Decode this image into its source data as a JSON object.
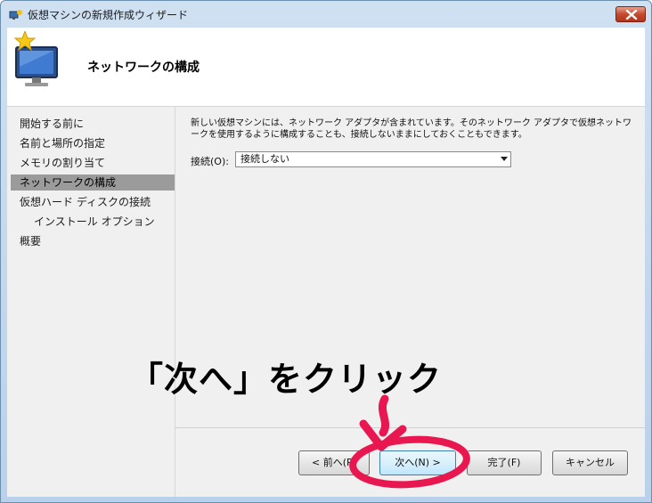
{
  "window": {
    "title": "仮想マシンの新規作成ウィザード"
  },
  "header": {
    "page_title": "ネットワークの構成"
  },
  "nav": {
    "items": [
      {
        "label": "開始する前に"
      },
      {
        "label": "名前と場所の指定"
      },
      {
        "label": "メモリの割り当て"
      },
      {
        "label": "ネットワークの構成"
      },
      {
        "label": "仮想ハード ディスクの接続"
      },
      {
        "label": "インストール オプション"
      },
      {
        "label": "概要"
      }
    ],
    "active_index": 3
  },
  "main": {
    "description": "新しい仮想マシンには、ネットワーク アダプタが含まれています。そのネットワーク アダプタで仮想ネットワークを使用するように構成することも、接続しないままにしておくこともできます。",
    "connection_label": "接続(O):",
    "connection_value": "接続しない"
  },
  "buttons": {
    "back": "< 前へ(P)",
    "next": "次へ(N) >",
    "finish": "完了(F)",
    "cancel": "キャンセル"
  },
  "annotation": {
    "text": "「次へ」をクリック",
    "color": "#e8174f"
  }
}
